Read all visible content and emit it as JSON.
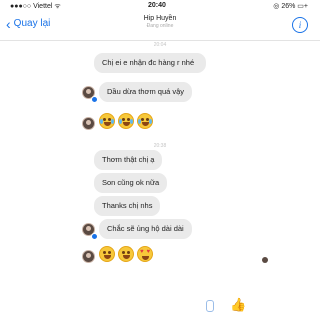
{
  "status": {
    "carrier": "●●●○○ Viettel ᯤ",
    "time": "20:40",
    "battery": "◎ 26% ▭+"
  },
  "nav": {
    "back_label": "Quay lại",
    "contact_name": "Hip Huyền",
    "contact_status": "Đang online"
  },
  "messages": [
    {
      "text": "Chị ei e nhận đc hàng r nhé"
    },
    {
      "text": "Dầu dừa thơm quá vậy"
    },
    {
      "text": "Thơm thật chị ạ"
    },
    {
      "text": "Son cũng ok nữa"
    },
    {
      "text": "Thanks chị nhs"
    },
    {
      "text": "Chắc sẽ ủng hộ dài dài"
    }
  ],
  "timestamps": [
    "20:04",
    "20:38"
  ],
  "colors": {
    "accent": "#1a73e8",
    "bubble": "#eaeaea"
  }
}
